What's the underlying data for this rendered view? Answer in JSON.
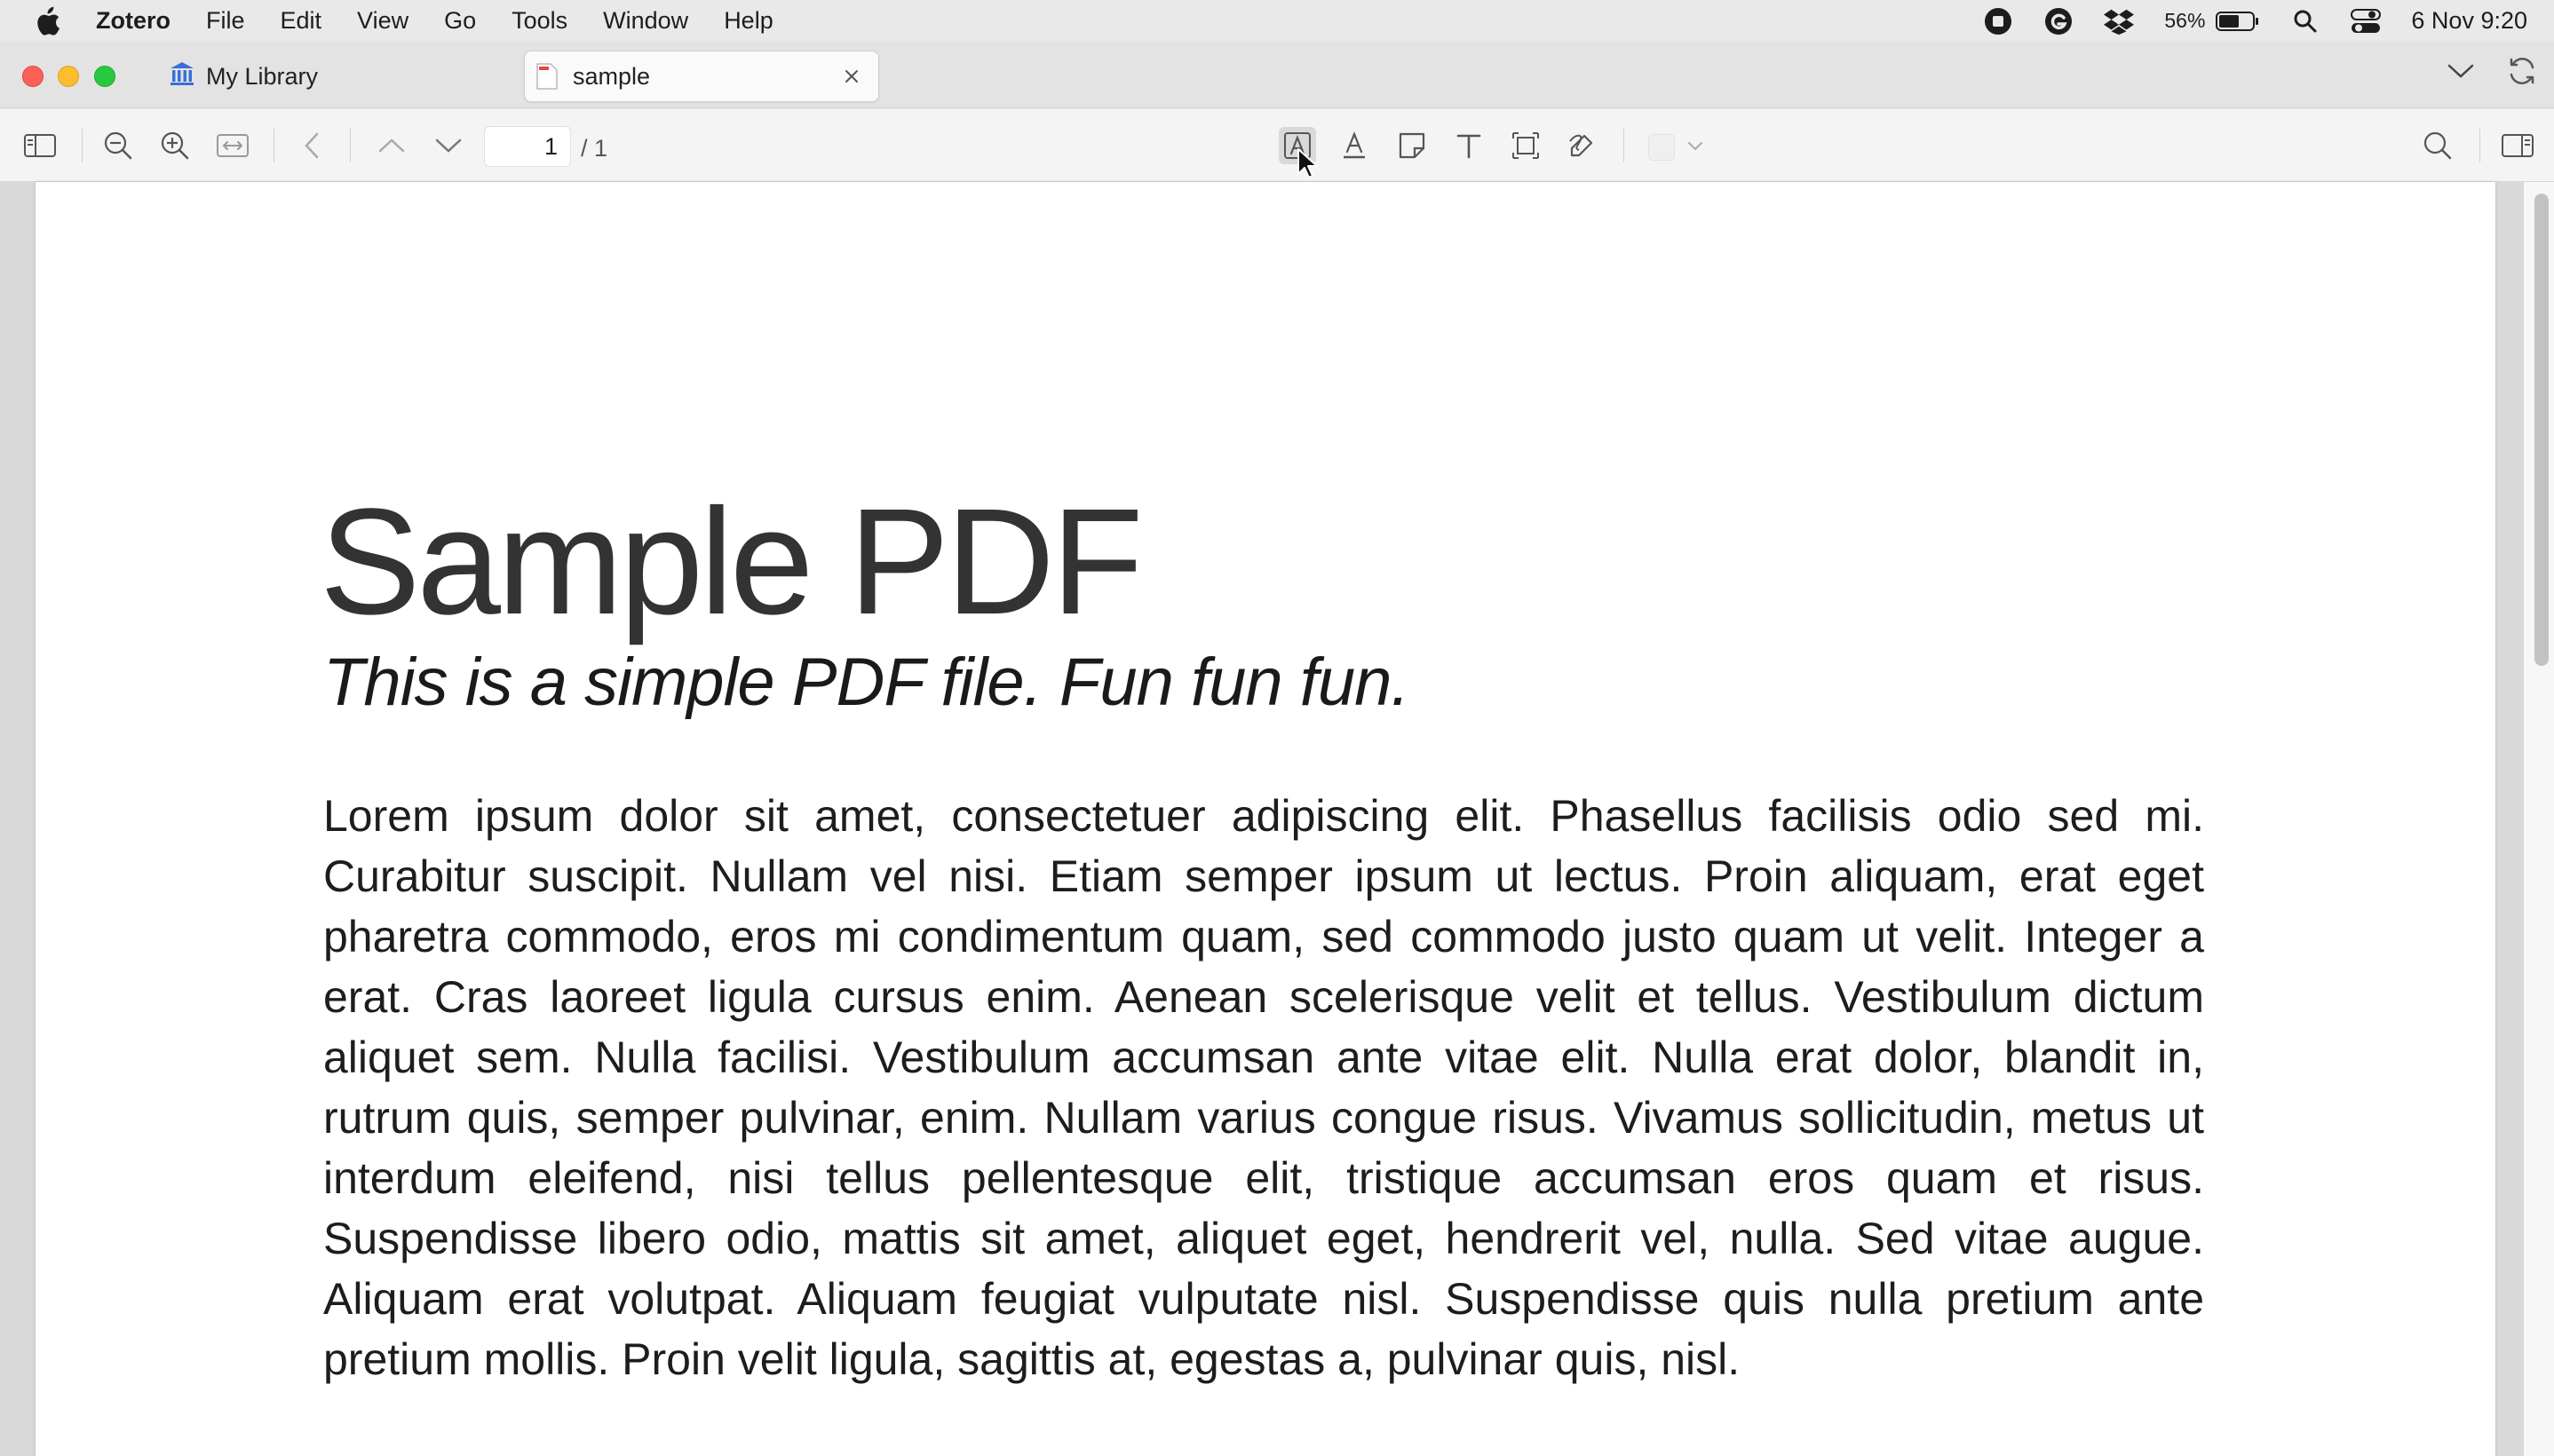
{
  "menubar": {
    "app_name": "Zotero",
    "menus": [
      "File",
      "Edit",
      "View",
      "Go",
      "Tools",
      "Window",
      "Help"
    ],
    "battery_percent": "56%",
    "datetime": "6 Nov  9:20"
  },
  "tabs": {
    "library_label": "My Library",
    "document_label": "sample"
  },
  "toolbar": {
    "current_page": "1",
    "total_pages": "/ 1"
  },
  "document": {
    "title": "Sample PDF",
    "subtitle": "This is a simple PDF file. Fun fun fun.",
    "body": "Lorem ipsum dolor sit amet, consectetuer adipiscing elit. Phasellus facilisis odio sed mi. Curabitur suscipit. Nullam vel nisi. Etiam semper ipsum ut lectus. Proin aliquam, erat eget pharetra commodo, eros mi condimentum quam, sed commodo justo quam ut velit. Integer a erat. Cras laoreet ligula cursus enim. Aenean scelerisque velit et tellus. Vestibulum dictum aliquet sem. Nulla facilisi. Vestibulum accumsan ante vitae elit. Nulla erat dolor, blandit in, rutrum quis, semper pulvinar, enim. Nullam varius congue risus. Vivamus sollicitudin, metus ut interdum eleifend, nisi tellus pellentesque elit, tristique accumsan eros quam et risus. Suspendisse libero odio, mattis sit amet, aliquet eget, hendrerit vel, nulla. Sed vitae augue. Aliquam erat volutpat. Aliquam feugiat vulputate nisl. Suspendisse quis nulla pretium ante pretium mollis. Proin velit ligula, sagittis at, egestas a, pulvinar quis, nisl."
  },
  "colors": {
    "close": "#fe5f57",
    "minimize": "#febc2e",
    "zoom": "#28c840",
    "library_icon": "#3b6fd6"
  }
}
